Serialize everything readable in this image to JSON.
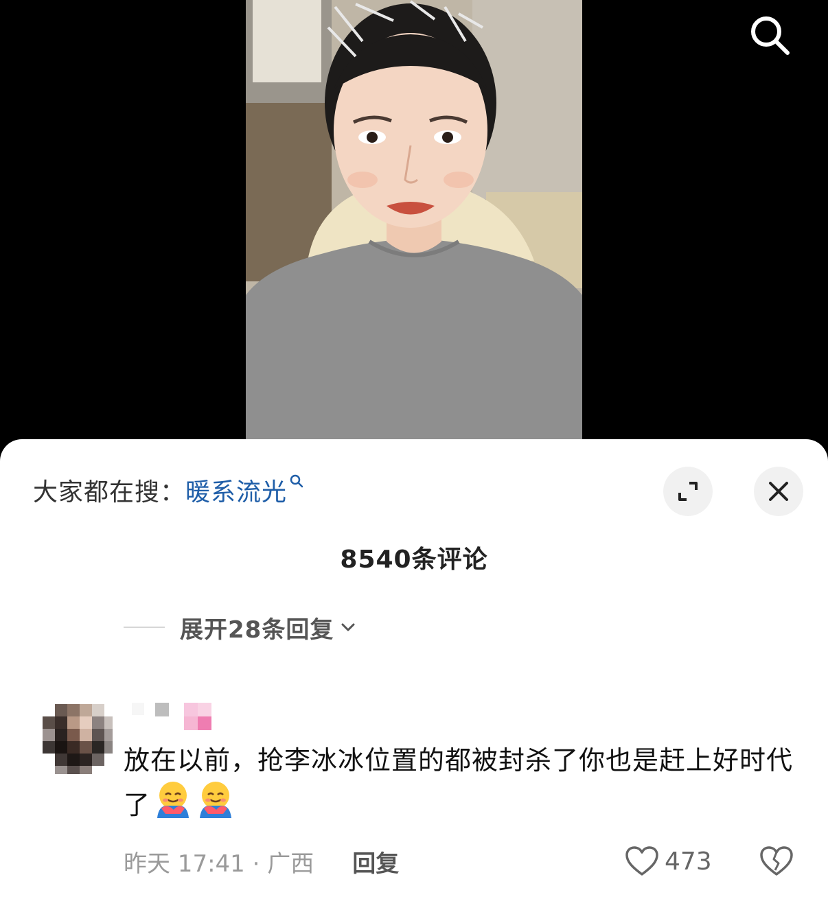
{
  "video": {
    "search_icon": "search-icon"
  },
  "sheet": {
    "suggest_prefix": "大家都在搜：",
    "suggest_link": "暖系流光",
    "expand_icon": "expand-icon",
    "close_icon": "close-icon",
    "comment_count": "8540条评论",
    "expand_replies": "展开28条回复"
  },
  "comment": {
    "text": "放在以前，抢李冰冰位置的都被封杀了你也是赶上好时代了",
    "emoji_name": "hugging-face-emoji",
    "time_location": "昨天 17:41 · 广西",
    "reply_label": "回复",
    "like_count": "473"
  },
  "colors": {
    "link": "#1f5ea8",
    "background_dark": "#000000",
    "sheet": "#ffffff"
  }
}
